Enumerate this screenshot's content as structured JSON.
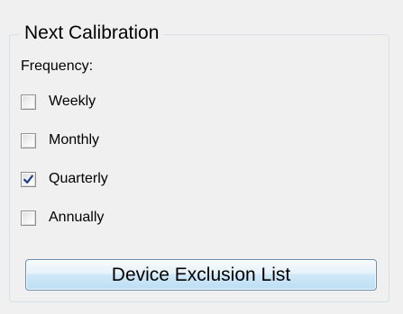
{
  "group": {
    "title": "Next Calibration"
  },
  "frequency": {
    "label": "Frequency:",
    "options": [
      {
        "label": "Weekly",
        "checked": false
      },
      {
        "label": "Monthly",
        "checked": false
      },
      {
        "label": "Quarterly",
        "checked": true
      },
      {
        "label": "Annually",
        "checked": false
      }
    ]
  },
  "exclusion_button": {
    "label": "Device Exclusion List"
  },
  "colors": {
    "window_background": "#f0f0f0",
    "check_mark": "#1c3f8c",
    "button_border": "#6d8fb4"
  },
  "icons": {
    "check": "check-mark-icon"
  }
}
